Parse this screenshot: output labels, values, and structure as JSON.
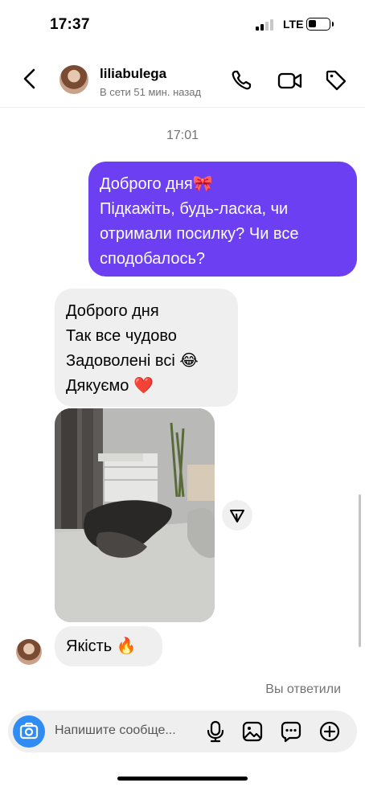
{
  "status_bar": {
    "time": "17:37",
    "network": "LTE",
    "signal_bars_active": 2,
    "signal_bars_total": 4
  },
  "header": {
    "username": "liliabulega",
    "presence": "В сети 51 мин. назад",
    "icons": [
      "back-icon",
      "phone-icon",
      "video-camera-icon",
      "tag-icon"
    ]
  },
  "chat": {
    "timestamp": "17:01",
    "outgoing_message": {
      "lines": [
        "Доброго дня🎀",
        "Підкажіть, будь-ласка, чи",
        "отримали посилку? Чи все",
        "сподобалось?"
      ]
    },
    "incoming_message": {
      "lines": [
        "Доброго дня",
        "Так все чудово",
        "Задоволені всі 😂",
        "Дякуємо ❤️"
      ]
    },
    "incoming_quality_message": "Якість 🔥",
    "replied_label": "Вы ответили"
  },
  "composer": {
    "placeholder": "Напишите сообще...",
    "icons": [
      "camera-icon",
      "microphone-icon",
      "gallery-icon",
      "sticker-icon",
      "plus-icon"
    ],
    "accent": "#2f8cf5"
  },
  "colors": {
    "outgoing_bubble": "#6c3ff3",
    "incoming_bubble": "#efefef",
    "secondary_text": "#737373"
  }
}
